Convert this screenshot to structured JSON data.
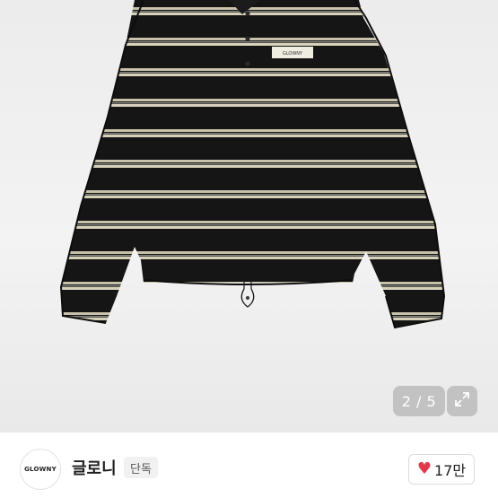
{
  "gallery": {
    "counter_text": "2 / 5",
    "expand_icon": "expand-arrows-icon",
    "product_label_text": "GLOWNY"
  },
  "seller": {
    "avatar_text": "GLOWNY",
    "name": "글로니",
    "badge": "단독"
  },
  "like": {
    "icon": "heart-icon",
    "count": "17만",
    "heart_color": "#e23a4d"
  }
}
